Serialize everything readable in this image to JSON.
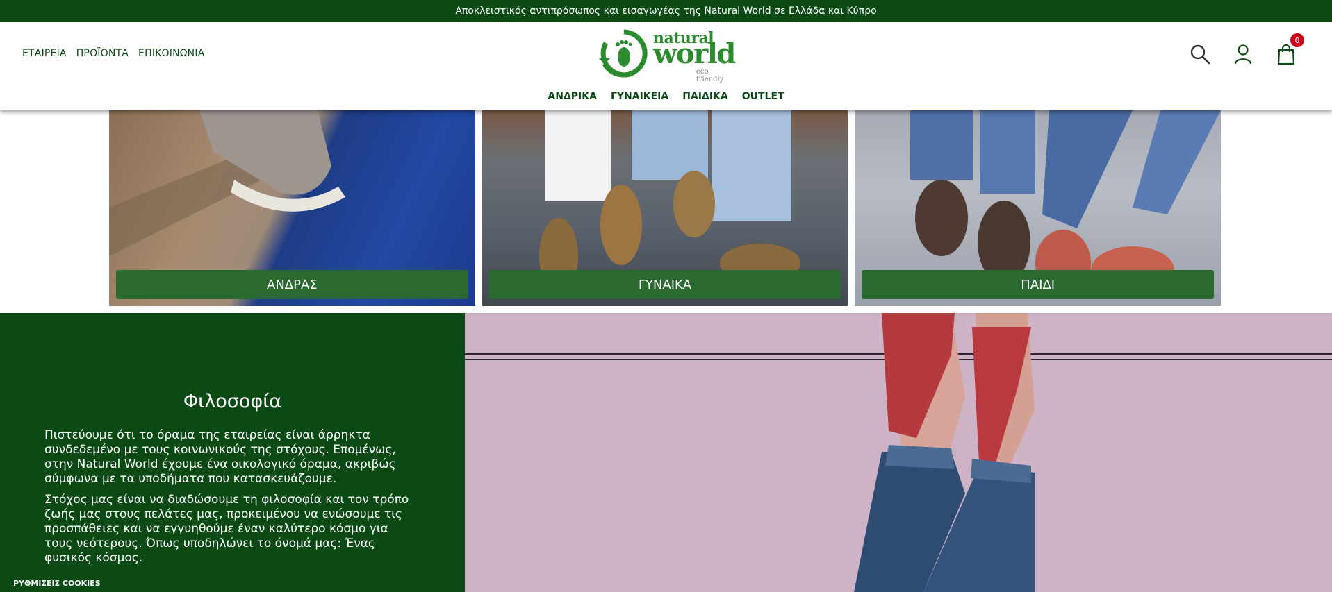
{
  "topbar": {
    "text": "Αποκλειστικός αντιπρόσωπος και εισαγωγέας της Natural World σε Ελλάδα και Κύπρο"
  },
  "header": {
    "left_nav": [
      "ΕΤΑΙΡΕΙΑ",
      "ΠΡΟΪΟΝΤΑ",
      "ΕΠΙΚΟΙΝΩΝΙΑ"
    ],
    "logo": {
      "line1": "natural",
      "line2": "world",
      "tagline": "eco friendly"
    },
    "main_nav": [
      "ΑΝΔΡΙΚΑ",
      "ΓΥΝΑΙΚΕΙΑ",
      "ΠΑΙΔΙΚΑ",
      "OUTLET"
    ],
    "cart_count": "0",
    "icons": {
      "search": "search-icon",
      "account": "user-icon",
      "cart": "shopping-bag-icon"
    }
  },
  "categories": [
    "ΑΝΔΡΑΣ",
    "ΓΥΝΑΙΚΑ",
    "ΠΑΙΔΙ"
  ],
  "philosophy": {
    "title": "Φιλοσοφία",
    "p1": "Πιστεύουμε ότι το όραμα της εταιρείας είναι άρρηκτα συνδεδεμένο με τους κοινωνικούς της στόχους. Επομένως, στην Natural World έχουμε ένα οικολογικό όραμα, ακριβώς σύμφωνα με τα υποδήματα που κατασκευάζουμε.",
    "p2": "Στόχος μας είναι να διαδώσουμε τη φιλοσοφία και τον τρόπο ζωής μας στους πελάτες μας, προκειμένου να ενώσουμε τις προσπάθειες και να εγγυηθούμε έναν καλύτερο κόσμο για τους νεότερους. Όπως υποδηλώνει το όνομά μας: Ένας φυσικός κόσμος."
  },
  "cookies": "ΡΥΘΜΙΣΕΙΣ COOKIES",
  "colors": {
    "brand_dark": "#0b4a14",
    "brand_green": "#2c8a2f",
    "label_green": "#2a6a31",
    "badge": "#d0021b"
  }
}
